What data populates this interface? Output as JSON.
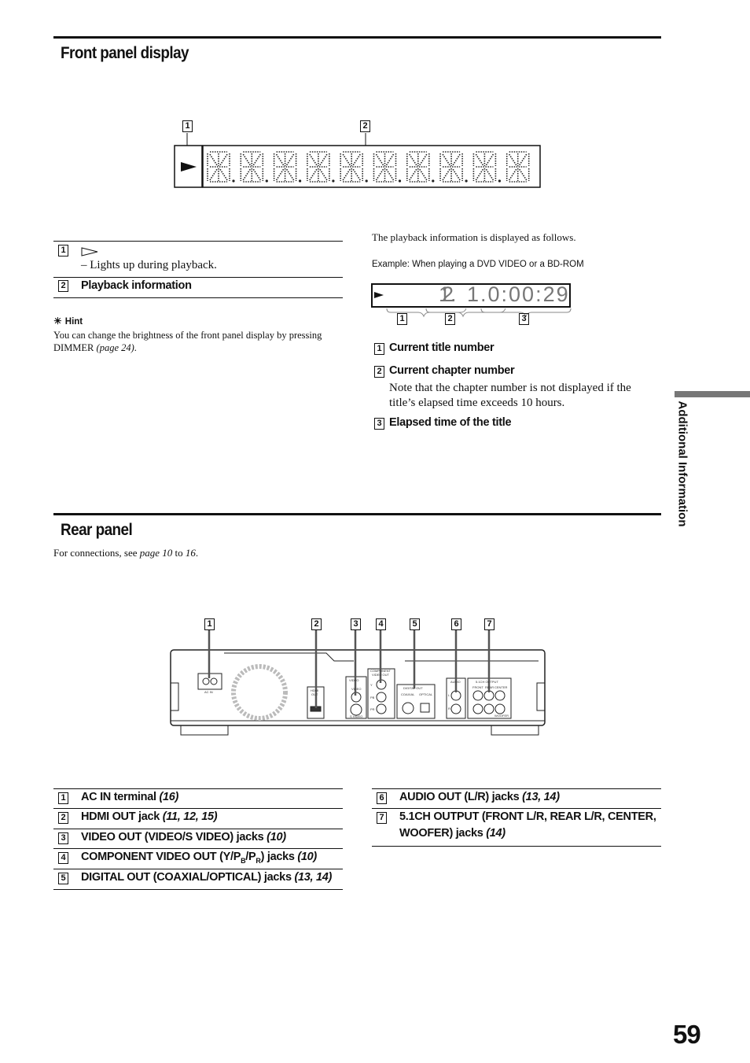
{
  "front_panel": {
    "title": "Front panel display",
    "callouts": [
      "1",
      "2"
    ],
    "table": [
      {
        "num": "1",
        "symbol": "play-outline-icon",
        "desc": "– Lights up during playback."
      },
      {
        "num": "2",
        "label": "Playback information"
      }
    ],
    "hint": {
      "label": "Hint",
      "text": "You can change the brightness of the front panel display by pressing DIMMER ",
      "ref": "(page 24)",
      "end": "."
    },
    "right": {
      "intro": "The playback information is displayed as follows.",
      "example": "Example: When playing a DVD VIDEO or a BD-ROM",
      "display": {
        "title": "1.",
        "chapter": "2",
        "time": "1.0:00:29"
      },
      "callouts": [
        "1",
        "2",
        "3"
      ],
      "items": [
        {
          "num": "1",
          "label": "Current title number"
        },
        {
          "num": "2",
          "label": "Current chapter number",
          "note": "Note that the chapter number is not displayed if the title’s elapsed time exceeds 10 hours."
        },
        {
          "num": "3",
          "label": "Elapsed time of the title"
        }
      ]
    }
  },
  "sidebar_tab": "Additional Information",
  "rear_panel": {
    "title": "Rear panel",
    "intro": {
      "pre": "For connections, see ",
      "p1": "page 10",
      "mid": " to ",
      "p2": "16",
      "end": "."
    },
    "callouts": [
      "1",
      "2",
      "3",
      "4",
      "5",
      "6",
      "7"
    ],
    "illustration_labels": {
      "ac_in": "AC IN",
      "hdmi": "HDMI",
      "out": "OUT",
      "video_out": "VIDEO",
      "video": "VIDEO",
      "s_video": "S VIDEO",
      "component": "COMPONENT",
      "video_out2": "VIDEO OUT",
      "y": "Y",
      "pb": "PB",
      "pr": "PR",
      "digital_out": "DIGITAL OUT",
      "coaxial": "COAXIAL",
      "optical": "OPTICAL",
      "audio": "AUDIO",
      "l": "L",
      "r": "R",
      "ch51": "5.1CH OUTPUT",
      "front": "FRONT",
      "rear": "REAR",
      "center": "CENTER",
      "woofer": "WOOFER"
    },
    "left_items": [
      {
        "num": "1",
        "label": "AC IN terminal ",
        "ref": "(16)"
      },
      {
        "num": "2",
        "label": "HDMI OUT jack ",
        "ref": "(11, 12, 15)"
      },
      {
        "num": "3",
        "label": "VIDEO OUT (VIDEO/S VIDEO) jacks ",
        "ref": "(10)"
      },
      {
        "num": "4",
        "label": "COMPONENT VIDEO OUT (Y/P",
        "sub1": "B",
        "mid": "/P",
        "sub2": "R",
        "after": ") jacks ",
        "ref": "(10)"
      },
      {
        "num": "5",
        "label": "DIGITAL OUT (COAXIAL/OPTICAL) jacks ",
        "ref": "(13, 14)"
      }
    ],
    "right_items": [
      {
        "num": "6",
        "label": "AUDIO OUT (L/R) jacks ",
        "ref": "(13, 14)"
      },
      {
        "num": "7",
        "label": "5.1CH OUTPUT (FRONT L/R, REAR L/R, CENTER,",
        "label2": "WOOFER) jacks ",
        "ref": "(14)"
      }
    ]
  },
  "page_number": "59"
}
